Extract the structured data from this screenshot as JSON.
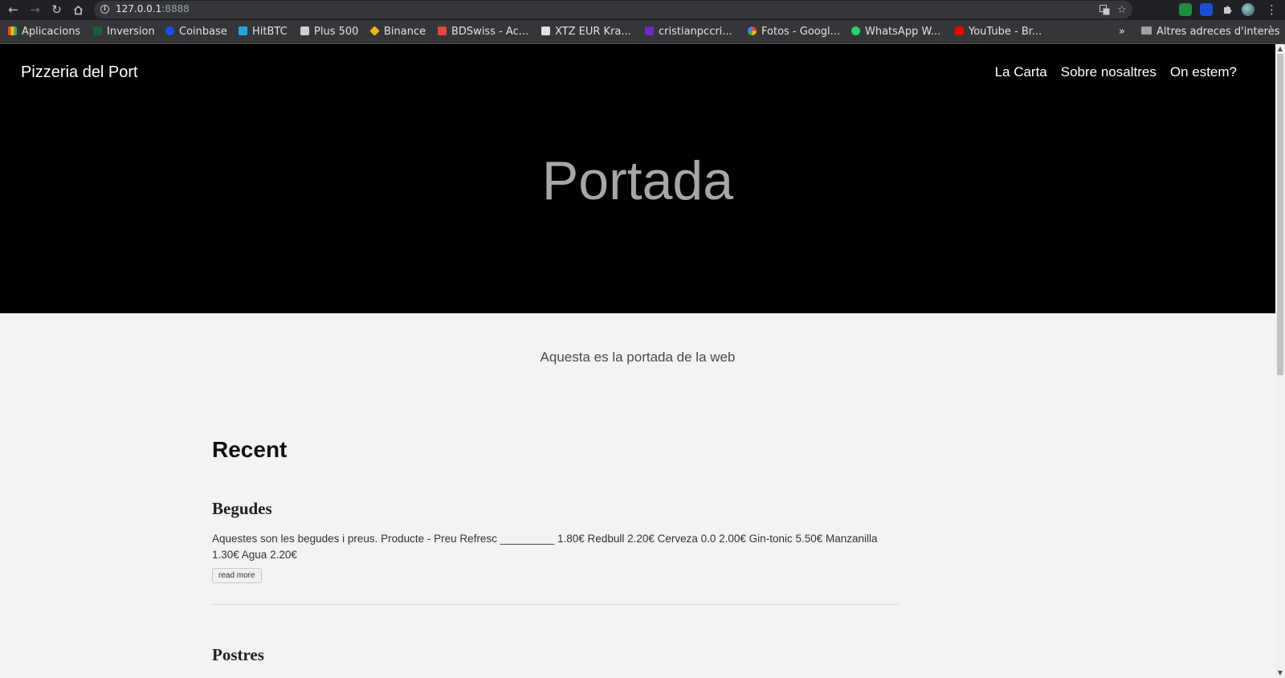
{
  "browser": {
    "url_host": "127.0.0.1",
    "url_port": ":8888",
    "bookmarks": [
      {
        "label": "Aplicacions",
        "icon": "apps-grid-icon",
        "color": "#e8453c"
      },
      {
        "label": "Inversion",
        "icon": "inversion-icon",
        "color": "#1db954"
      },
      {
        "label": "Coinbase",
        "icon": "coinbase-icon",
        "color": "#1652f0"
      },
      {
        "label": "HitBTC",
        "icon": "hitbtc-icon",
        "color": "#28a3e2"
      },
      {
        "label": "Plus 500",
        "icon": "plus500-icon",
        "color": "#d0d0d0"
      },
      {
        "label": "Binance",
        "icon": "binance-icon",
        "color": "#f0b90b"
      },
      {
        "label": "BDSwiss - Ac...",
        "icon": "bdswiss-icon",
        "color": "#e8453c"
      },
      {
        "label": "XTZ EUR Kra...",
        "icon": "investing-icon",
        "color": "#e0e0e0"
      },
      {
        "label": "cristianpccri...",
        "icon": "mail-icon",
        "color": "#6f2dbd"
      },
      {
        "label": "Fotos - Googl...",
        "icon": "google-photos-icon",
        "color": "#fbbc05"
      },
      {
        "label": "WhatsApp W...",
        "icon": "whatsapp-icon",
        "color": "#25d366"
      },
      {
        "label": "YouTube - Br...",
        "icon": "youtube-icon",
        "color": "#ff0000"
      }
    ],
    "overflow_label": "»",
    "other_bookmarks": "Altres adreces d'interès"
  },
  "site": {
    "brand": "Pizzeria del Port",
    "nav": [
      "La Carta",
      "Sobre nosaltres",
      "On estem?"
    ],
    "hero_title": "Portada",
    "tagline": "Aquesta es la portada de la web",
    "recent_heading": "Recent",
    "posts": [
      {
        "title": "Begudes",
        "excerpt": "Aquestes son les begudes i preus. Producte - Preu Refresc _________ 1.80€ Redbull 2.20€ Cerveza 0.0 2.00€ Gin-tonic 5.50€ Manzanilla 1.30€ Agua 2.20€",
        "read_more": "read more"
      },
      {
        "title": "Postres"
      }
    ]
  }
}
